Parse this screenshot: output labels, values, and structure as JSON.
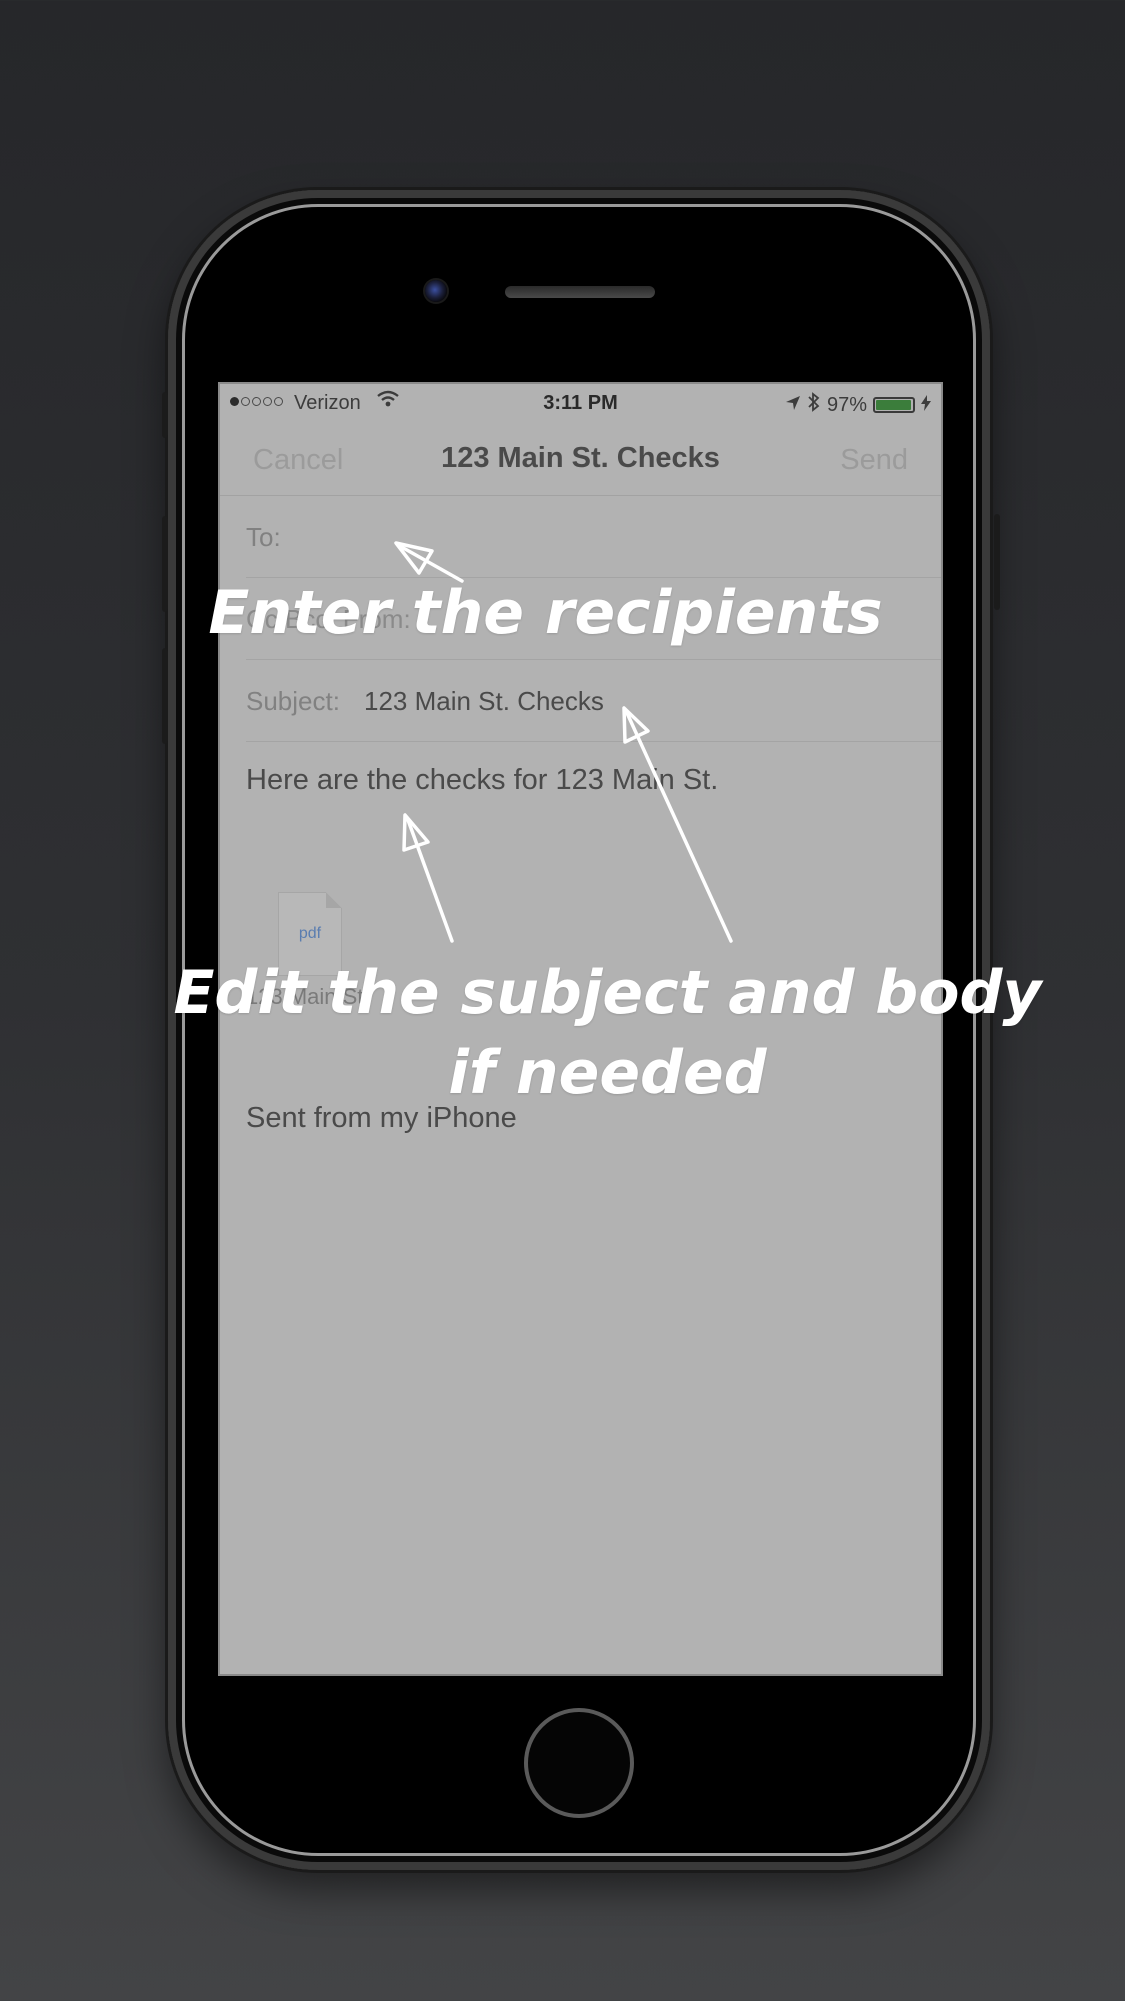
{
  "status_bar": {
    "carrier": "Verizon",
    "time": "3:11 PM",
    "battery": "97%",
    "battery_level": 0.97,
    "icons": [
      "signal-dots-icon",
      "wifi-icon",
      "location-arrow-icon",
      "bluetooth-icon",
      "battery-icon",
      "charging-bolt-icon"
    ]
  },
  "nav": {
    "cancel_label": "Cancel",
    "title": "123 Main St. Checks",
    "send_label": "Send"
  },
  "fields": {
    "to_label": "To:",
    "to_value": "",
    "cc_label": "Cc/Bcc, From:",
    "subject_label": "Subject:",
    "subject_value": "123 Main St. Checks"
  },
  "body": {
    "text": "Here are the checks for 123 Main St.",
    "attachment_ext": "pdf",
    "attachment_name": "123 Main St",
    "signature": "Sent from my iPhone"
  },
  "annotations": {
    "recipients": "Enter the recipients",
    "subject_body_line1": "Edit the subject and body",
    "subject_body_line2": "if needed"
  },
  "colors": {
    "background": "#2f3033",
    "screen_dim": "#b2b2b2",
    "annotation": "#ffffff"
  }
}
